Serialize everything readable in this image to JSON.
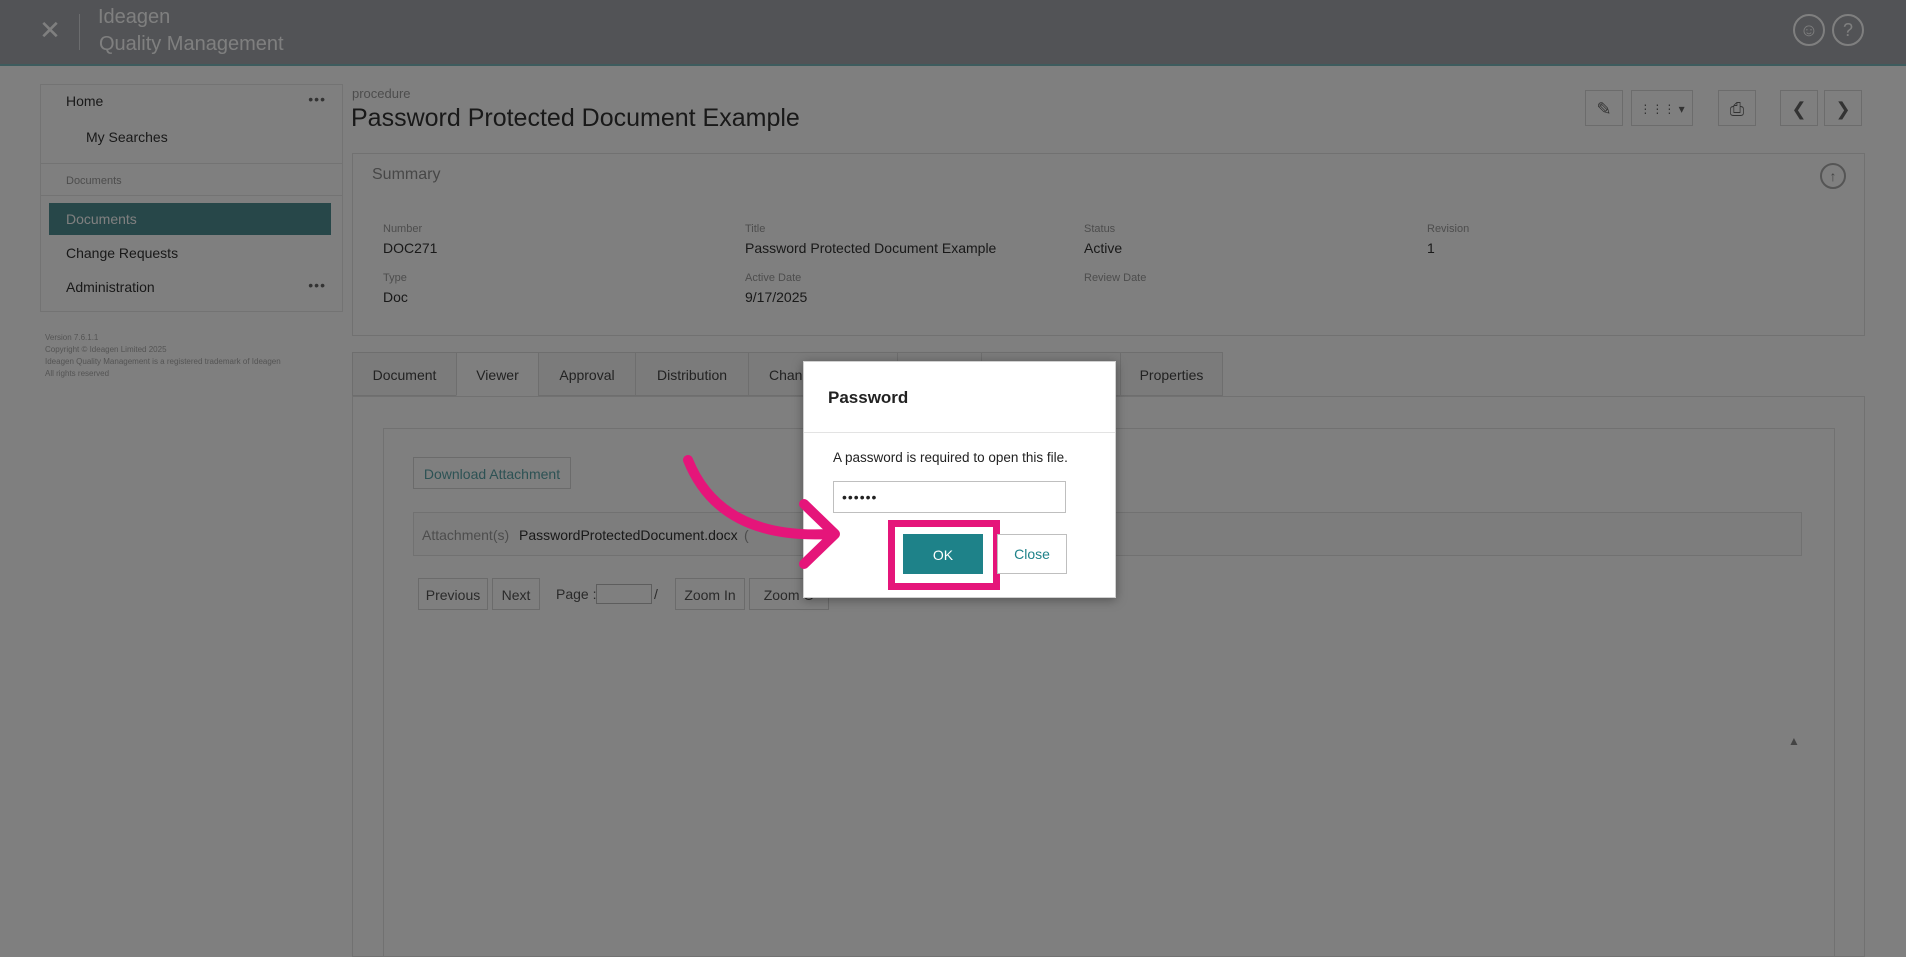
{
  "app": {
    "brand_line1": "Ideagen",
    "brand_line2": "Quality Management",
    "close_glyph": "✕",
    "user_icon_glyph": "☺",
    "help_icon_glyph": "?"
  },
  "sidebar": {
    "items": [
      {
        "label": "Home",
        "dots": "•••"
      },
      {
        "label": "My Searches"
      },
      {
        "label": "Documents",
        "section": "Documents"
      },
      {
        "label": "Change Requests"
      },
      {
        "label": "Administration",
        "dots": "•••"
      }
    ],
    "footer": "Version 7.6.1.1\nCopyright © Ideagen Limited 2025\nIdeagen Quality Management is a registered trademark of Ideagen\nAll rights reserved"
  },
  "header": {
    "breadcrumb": "procedure",
    "title": "Password Protected Document Example",
    "toolbar": {
      "edit_icon": "✎",
      "grid_icon": "⋮⋮⋮ ▾",
      "print_icon": "⎙",
      "prev_icon": "❮",
      "next_icon": "❯"
    }
  },
  "summary": {
    "title": "Summary",
    "collapse_icon": "↑",
    "fields": {
      "number_label": "Number",
      "number_value": "DOC271",
      "title_label": "Title",
      "title_value": "Password Protected Document Example",
      "status_label": "Status",
      "status_value": "Active",
      "revision_label": "Revision",
      "revision_value": "1",
      "type_label": "Type",
      "type_value": "Doc",
      "active_date_label": "Active Date",
      "active_date_value": "9/17/2025",
      "review_date_label": "Review Date"
    }
  },
  "tabs": [
    {
      "label": "Document"
    },
    {
      "label": "Viewer"
    },
    {
      "label": "Approval"
    },
    {
      "label": "Distribution"
    },
    {
      "label": "Chan"
    },
    {
      "label": ""
    },
    {
      "label": ""
    },
    {
      "label": "Properties"
    }
  ],
  "viewer": {
    "download_label": "Download Attachment",
    "attachment_label": "Attachment(s)",
    "attachment_file": "PasswordProtectedDocument.docx",
    "attachment_suffix": "(",
    "previous_label": "Previous",
    "next_label": "Next",
    "page_label": "Page :",
    "page_sep": "/",
    "zoom_in_label": "Zoom In",
    "zoom_out_label": "Zoom O",
    "scroll_up_glyph": "▲"
  },
  "dialog": {
    "title": "Password",
    "message": "A password is required to open this file.",
    "password_value": "••••••",
    "ok_label": "OK",
    "close_label": "Close"
  },
  "colors": {
    "accent": "#1e8289",
    "highlight": "#e5157a",
    "sidebar_active": "#4f8f93"
  }
}
